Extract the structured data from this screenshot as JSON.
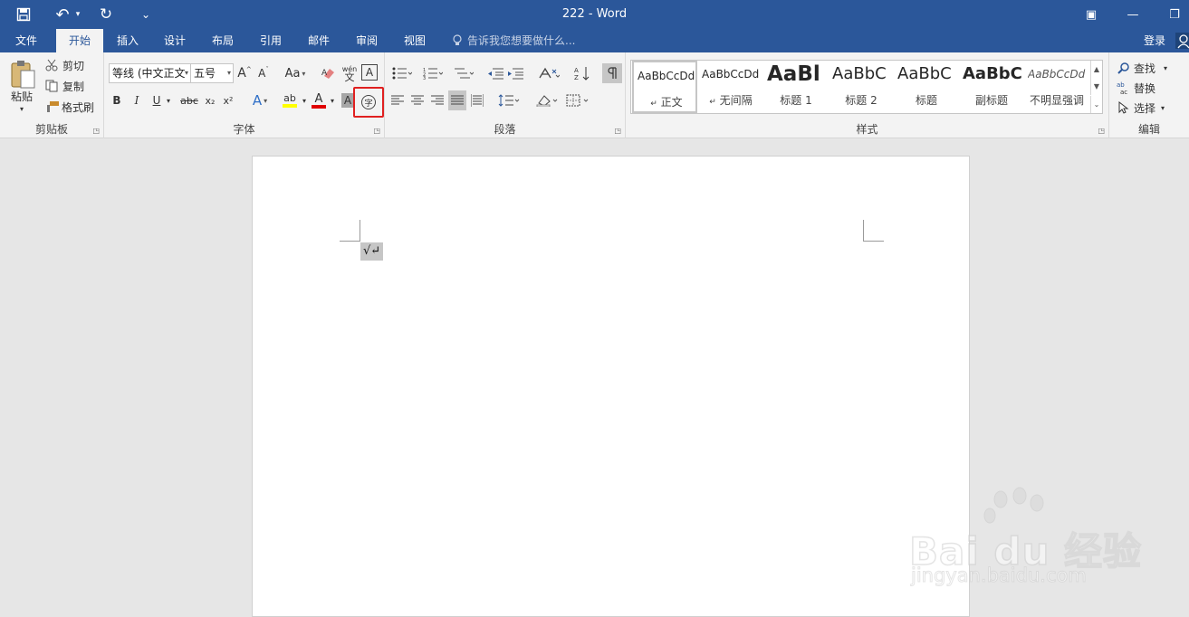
{
  "window": {
    "title": "222 - Word"
  },
  "qat": {
    "save_icon": "save-icon",
    "undo_icon": "undo-icon",
    "redo_icon": "redo-icon",
    "customize_icon": "customize-qat-icon",
    "undo_glyph": "↶",
    "redo_glyph": "↻",
    "save_glyph": "🖫",
    "more_glyph": "⌄",
    "drop_glyph": "▾"
  },
  "window_controls": {
    "restore_ribbon": "▣",
    "minimize": "—",
    "maximize": "❐"
  },
  "tabs": {
    "items": [
      "文件",
      "开始",
      "插入",
      "设计",
      "布局",
      "引用",
      "邮件",
      "审阅",
      "视图"
    ],
    "active": "开始",
    "tell_me": "告诉我您想要做什么...",
    "signin": "登录"
  },
  "clipboard": {
    "paste": "粘贴",
    "cut": "剪切",
    "copy": "复制",
    "format_painter": "格式刷",
    "group_label": "剪贴板"
  },
  "font": {
    "font_name": "等线 (中文正文",
    "font_size": "五号",
    "group_label": "字体",
    "grow": "A",
    "shrink": "A",
    "case": "Aa",
    "bold": "B",
    "italic": "I",
    "underline": "U",
    "strike": "abc",
    "sub": "x₂",
    "sup": "x²",
    "phonetic_top": "wén",
    "phonetic_bottom": "文",
    "char_border": "A",
    "font_color": "A",
    "highlight": "ab",
    "effects": "A",
    "shading": "A",
    "enclose": "字"
  },
  "paragraph": {
    "group_label": "段落"
  },
  "styles": {
    "group_label": "样式",
    "items": [
      {
        "preview": "AaBbCcDd",
        "name": "正文",
        "mark": "↵"
      },
      {
        "preview": "AaBbCcDd",
        "name": "无间隔",
        "mark": "↵"
      },
      {
        "preview": "AaBl",
        "name": "标题 1",
        "mark": ""
      },
      {
        "preview": "AaBbC",
        "name": "标题 2",
        "mark": ""
      },
      {
        "preview": "AaBbC",
        "name": "标题",
        "mark": ""
      },
      {
        "preview": "AaBbC",
        "name": "副标题",
        "mark": ""
      },
      {
        "preview": "AaBbCcDd",
        "name": "不明显强调",
        "mark": ""
      }
    ]
  },
  "editing": {
    "find": "查找",
    "replace": "替换",
    "select": "选择",
    "group_label": "编辑"
  },
  "document": {
    "content": "√↵"
  },
  "watermark": {
    "brand": "Bai du 经验",
    "url": "jingyan.baidu.com"
  },
  "colors": {
    "accent": "#2b579a",
    "ribbon": "#f3f3f3",
    "highlight_box": "#e02020",
    "font_red": "#e00000",
    "highlight_yellow": "#ffff00"
  }
}
